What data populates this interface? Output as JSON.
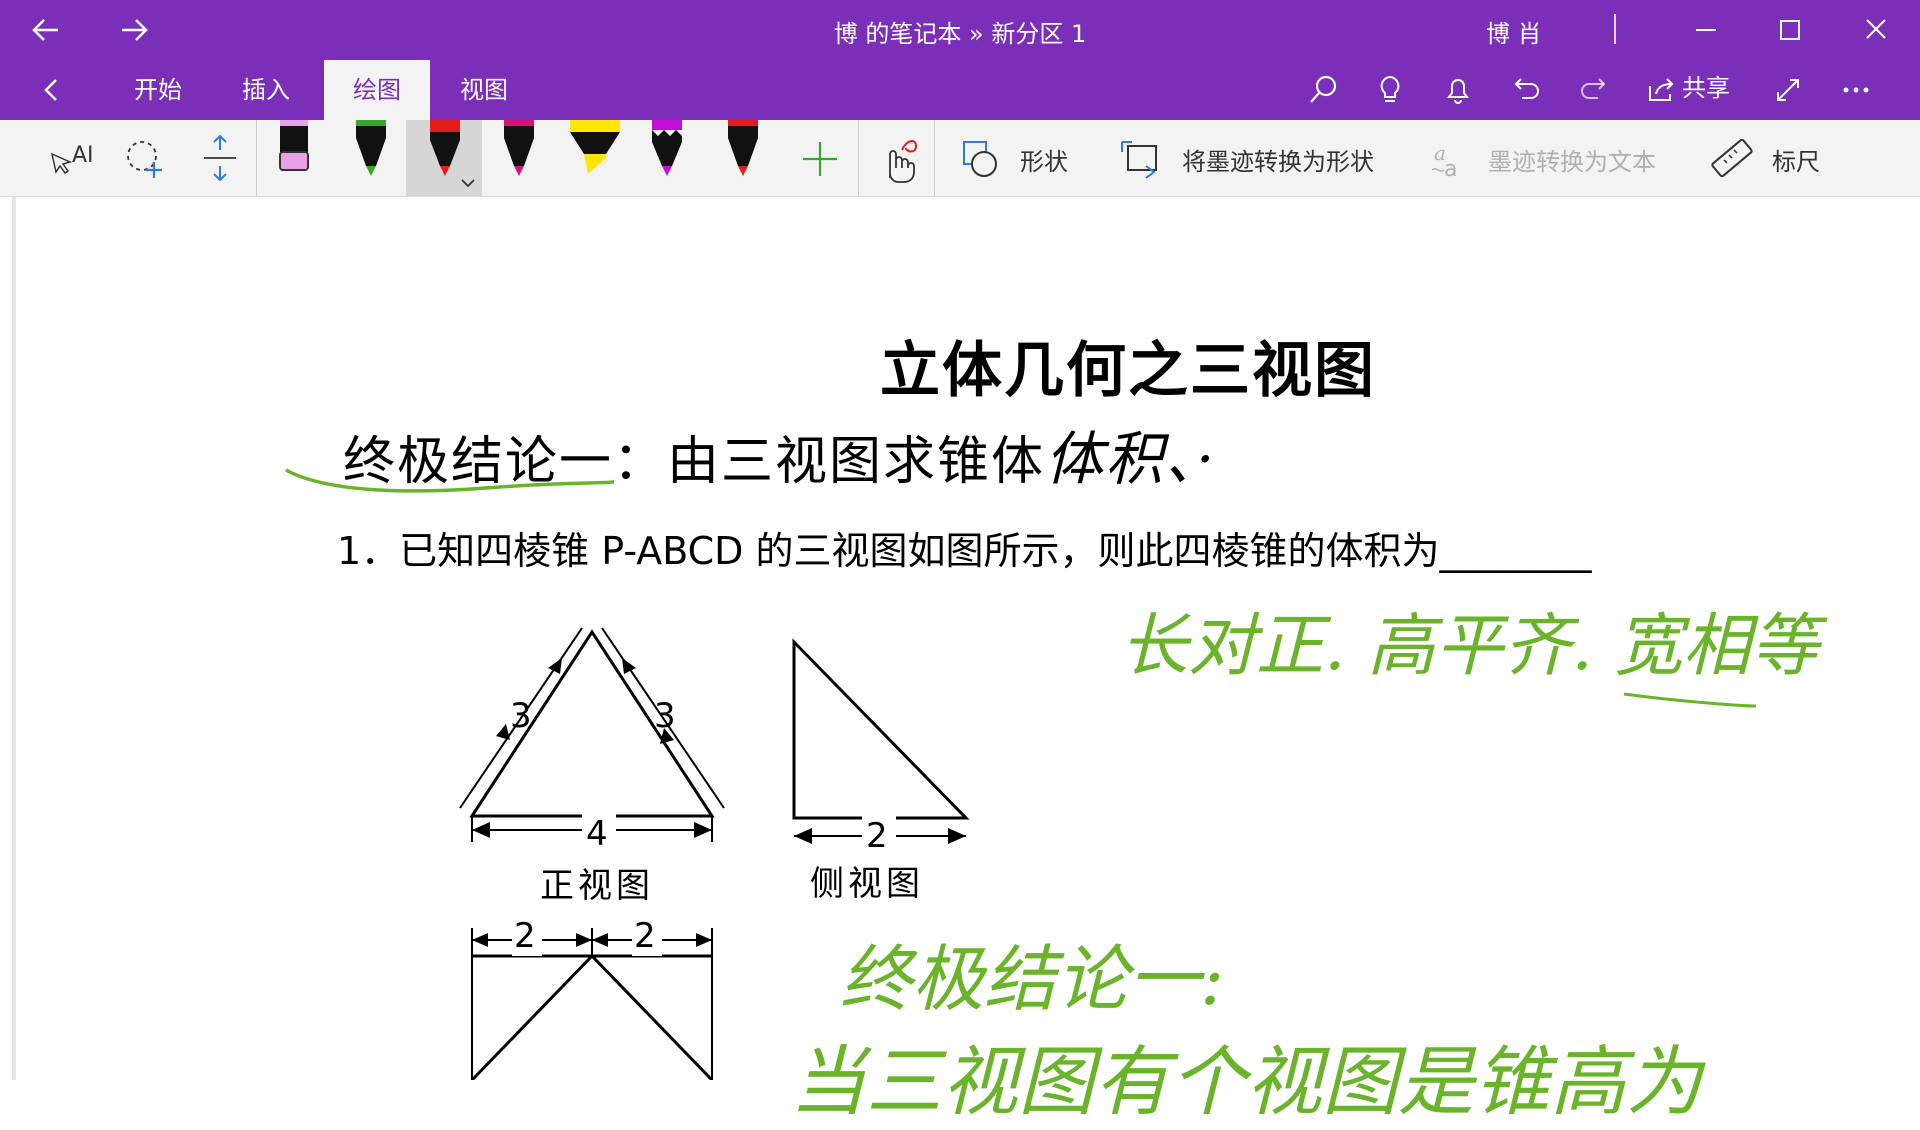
{
  "window": {
    "title": "博 的笔记本 » 新分区 1",
    "user": "博 肖"
  },
  "ribbon": {
    "tabs": [
      {
        "label": "开始"
      },
      {
        "label": "插入"
      },
      {
        "label": "绘图"
      },
      {
        "label": "视图"
      }
    ],
    "share_label": "共享"
  },
  "toolbar": {
    "shapes_label": "形状",
    "ink_to_shape_label": "将墨迹转换为形状",
    "ink_to_text_label": "墨迹转换为文本",
    "ruler_label": "标尺"
  },
  "pens": [
    {
      "color": "#e8a0e8"
    },
    {
      "color": "#3aa52e"
    },
    {
      "color": "#e51c1c"
    },
    {
      "color": "#d4147a"
    },
    {
      "color": "#ffe600"
    },
    {
      "color": "#c40ed8"
    },
    {
      "color": "#e51c1c"
    }
  ],
  "note": {
    "heading": "立体几何之三视图",
    "subheading": "终极结论一：由三视图求锥体",
    "subheading_ink": "体积、·",
    "question": "1．已知四棱锥 P-ABCD 的三视图如图所示，则此四棱锥的体积为________",
    "front_view_label": "正视图",
    "side_view_label": "侧视图",
    "dim_3_left": "3",
    "dim_3_right": "3",
    "dim_4": "4",
    "dim_2_side": "2",
    "dim_2_top_left": "2",
    "dim_2_top_right": "2",
    "ink_note_1": "长对正. 高平齐. 宽相等",
    "ink_note_2": "终极结论一:",
    "ink_note_3": "当三视图有个视图是锥高为"
  },
  "colors": {
    "accent": "#7b2fb8",
    "ink_green": "#6ab42a"
  }
}
